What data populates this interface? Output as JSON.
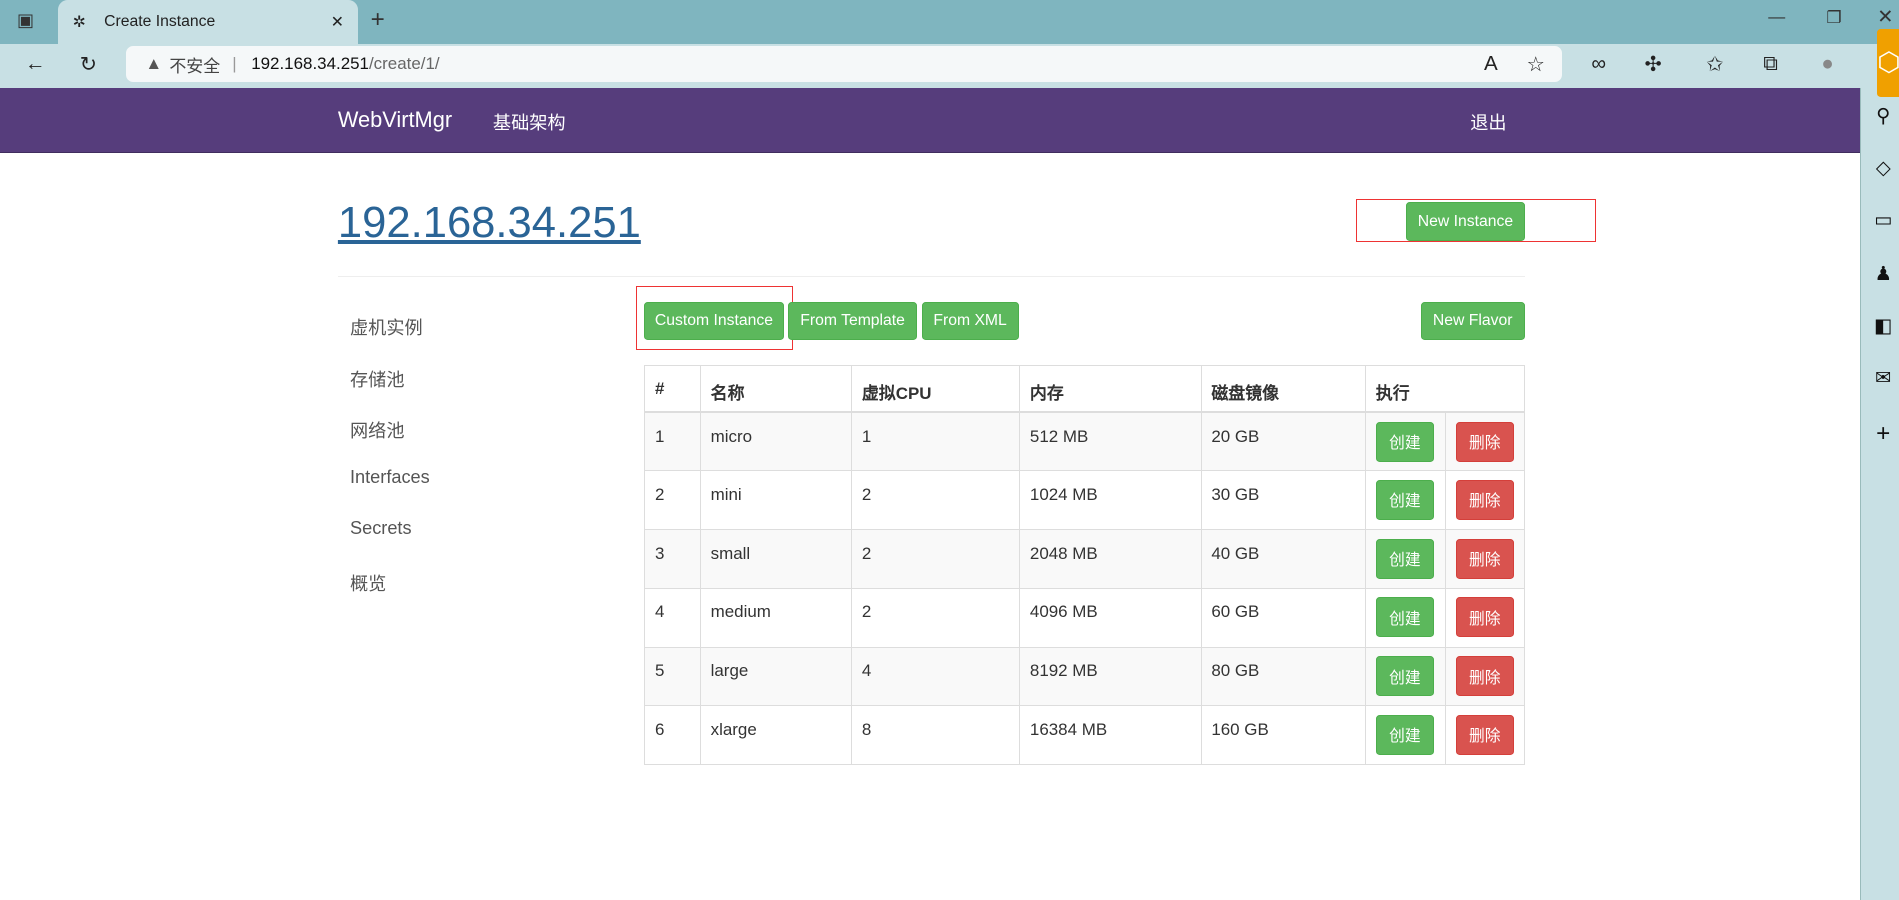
{
  "browser": {
    "tab_title": "Create Instance",
    "security_label": "不安全",
    "url_host": "192.168.34.251",
    "url_path": "/create/1/"
  },
  "nav": {
    "brand": "WebVirtMgr",
    "infrastructure": "基础架构",
    "logout": "退出",
    "color": "#563d7c"
  },
  "page": {
    "title": "192.168.34.251",
    "new_instance": "New Instance"
  },
  "sidebar": {
    "items": [
      {
        "label": "虚机实例"
      },
      {
        "label": "存储池"
      },
      {
        "label": "网络池"
      },
      {
        "label": "Interfaces"
      },
      {
        "label": "Secrets"
      },
      {
        "label": "概览"
      }
    ]
  },
  "toolbar": {
    "custom": "Custom Instance",
    "template": "From Template",
    "xml": "From XML",
    "new_flavor": "New Flavor"
  },
  "table": {
    "headers": [
      "#",
      "名称",
      "虚拟CPU",
      "内存",
      "磁盘镜像",
      "执行"
    ],
    "create_label": "创建",
    "delete_label": "删除",
    "rows": [
      [
        "1",
        "micro",
        "1",
        "512 MB",
        "20 GB"
      ],
      [
        "2",
        "mini",
        "2",
        "1024 MB",
        "30 GB"
      ],
      [
        "3",
        "small",
        "2",
        "2048 MB",
        "40 GB"
      ],
      [
        "4",
        "medium",
        "2",
        "4096 MB",
        "60 GB"
      ],
      [
        "5",
        "large",
        "4",
        "8192 MB",
        "80 GB"
      ],
      [
        "6",
        "xlarge",
        "8",
        "16384 MB",
        "160 GB"
      ]
    ]
  }
}
